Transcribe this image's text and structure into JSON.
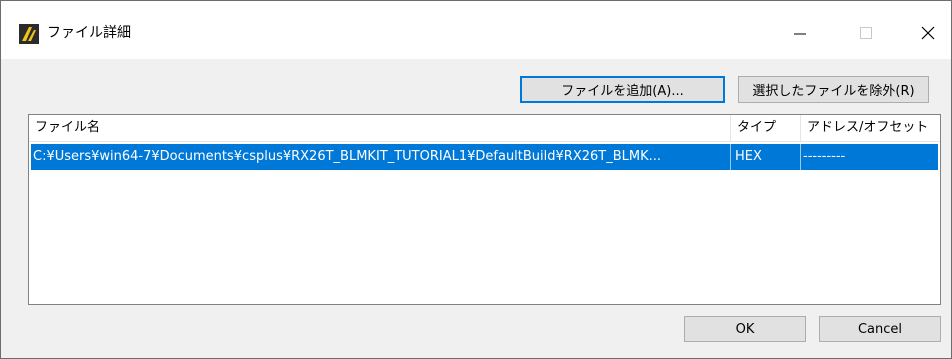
{
  "window": {
    "title": "ファイル詳細"
  },
  "toolbar": {
    "add_label": "ファイルを追加(A)...",
    "remove_label": "選択したファイルを除外(R)"
  },
  "table": {
    "columns": [
      "ファイル名",
      "タイプ",
      "アドレス/オフセット"
    ],
    "rows": [
      {
        "file": "C:¥Users¥win64-7¥Documents¥csplus¥RX26T_BLMKIT_TUTORIAL1¥DefaultBuild¥RX26T_BLMK...",
        "type": "HEX",
        "address": "---------"
      }
    ]
  },
  "buttons": {
    "ok_label": "OK",
    "cancel_label": "Cancel"
  },
  "colors": {
    "selection": "#0078d7",
    "default_button_border": "#0078d7"
  }
}
